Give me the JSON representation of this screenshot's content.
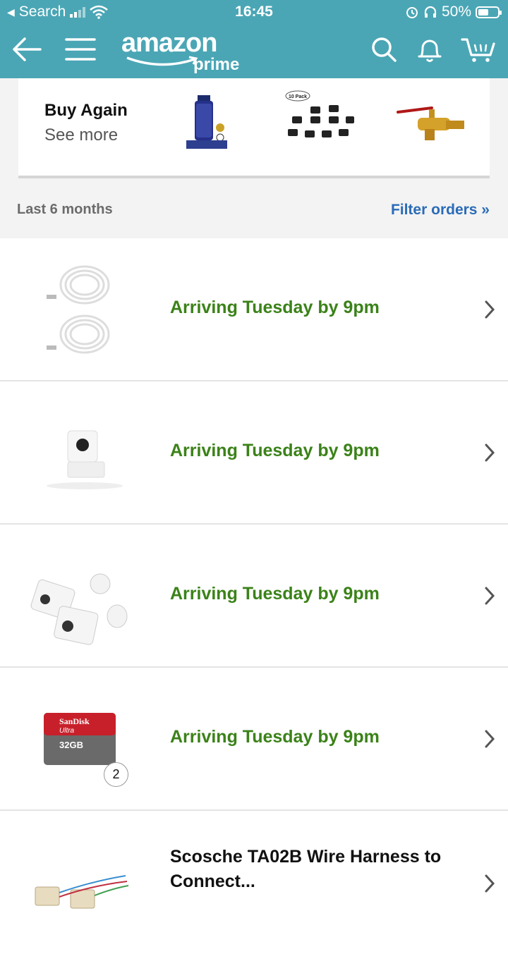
{
  "status_bar": {
    "back_app": "Search",
    "time": "16:45",
    "battery": "50%"
  },
  "header": {
    "logo_word": "amazon",
    "logo_sub": "prime",
    "icons": [
      "back-arrow-icon",
      "menu-icon",
      "search-icon",
      "bell-icon",
      "cart-icon"
    ]
  },
  "buy_again": {
    "title": "Buy Again",
    "see_more": "See more",
    "items": [
      "water-filter",
      "10-pack-cat6-couplers",
      "brass-valve"
    ],
    "pack_label": "10 Pack"
  },
  "orders_header": {
    "period": "Last 6 months",
    "filter": "Filter orders »"
  },
  "orders": [
    {
      "status": "Arriving Tuesday by 9pm",
      "image": "usb-cables"
    },
    {
      "status": "Arriving Tuesday by 9pm",
      "image": "white-camera"
    },
    {
      "status": "Arriving Tuesday by 9pm",
      "image": "two-wall-cameras"
    },
    {
      "status": "Arriving Tuesday by 9pm",
      "image": "sandisk-card",
      "quantity": "2",
      "card_brand": "SanDisk",
      "card_sub": "Ultra",
      "card_size": "32GB"
    },
    {
      "title": "Scosche TA02B Wire Harness to Connect...",
      "image": "wire-harness"
    }
  ],
  "colors": {
    "header": "#4aa6b5",
    "status_green": "#3b8219",
    "link_blue": "#2a6bb8"
  }
}
